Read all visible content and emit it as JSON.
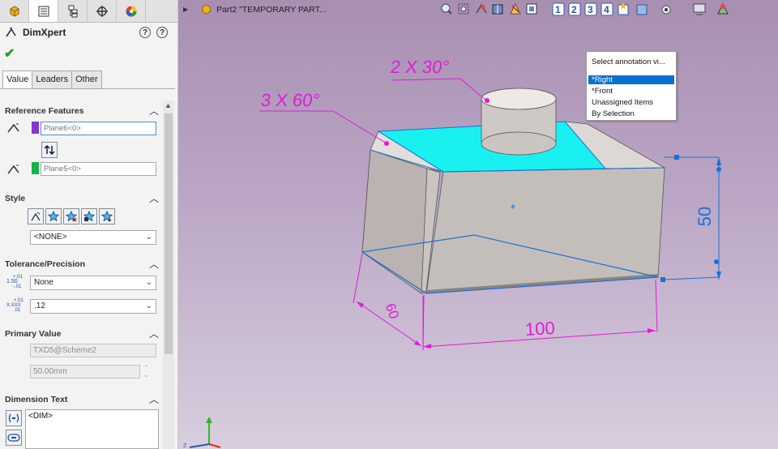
{
  "panel": {
    "title": "DimXpert",
    "help_glyph": "?",
    "tabs": [
      "Value",
      "Leaders",
      "Other"
    ],
    "reference": {
      "heading": "Reference Features",
      "field1": "Plane6<0>",
      "field2": "Plane5<0>",
      "colors": {
        "field1": "#8a35c9",
        "field2": "#19b34a"
      }
    },
    "style": {
      "heading": "Style",
      "value": "<NONE>"
    },
    "tolerance": {
      "heading": "Tolerance/Precision",
      "type_value": "None",
      "precision_value": ".12",
      "tol_icon_num": "1.50",
      "tol_icon_plus": "+.01",
      "tol_icon_minus": "-.01",
      "prec_icon_num": "X.XXX",
      "prec_icon_plus": "+.01",
      "prec_icon_minus": ".01"
    },
    "primary": {
      "heading": "Primary Value",
      "name": "TXD5@Scheme2",
      "value": "50.00mm"
    },
    "dimension_text": {
      "heading": "Dimension Text",
      "value": "<DIM>"
    }
  },
  "viewport": {
    "doc_title": "Part2 \"TEMPORARY PART...",
    "annotations": {
      "chamfer1": "2 X 30°",
      "chamfer2": "3 X 60°",
      "height": "50",
      "length": "100",
      "depth": "60"
    },
    "dropdown": {
      "header": "Select annotation vi...",
      "items": [
        "*Right",
        "*Front",
        "Unassigned Items",
        "By Selection"
      ],
      "selected_index": 0
    },
    "colors": {
      "annotation": "#e01bd8",
      "dimension": "#1a6fd6",
      "highlight": "#19f1f1"
    }
  }
}
